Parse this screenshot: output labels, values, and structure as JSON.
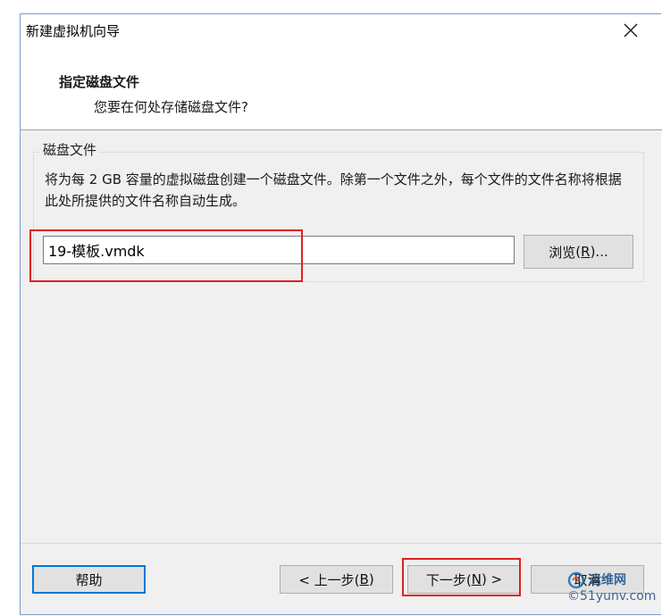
{
  "window": {
    "title": "新建虚拟机向导"
  },
  "header": {
    "title": "指定磁盘文件",
    "subtitle": "您要在何处存储磁盘文件?"
  },
  "disk_group": {
    "legend": "磁盘文件",
    "description": "将为每 2 GB 容量的虚拟磁盘创建一个磁盘文件。除第一个文件之外，每个文件的文件名称将根据此处所提供的文件名称自动生成。",
    "file_value": "19-模板.vmdk",
    "browse_label": "浏览",
    "browse_key": "R",
    "browse_suffix": ")..."
  },
  "buttons": {
    "help": "帮助",
    "back_prefix": "< 上一步(",
    "back_key": "B",
    "back_suffix": ")",
    "next_prefix": "下一步(",
    "next_key": "N",
    "next_suffix": ") >",
    "cancel": "取消"
  },
  "watermark": {
    "brand": "运维网",
    "site": "©51yunv.com"
  },
  "colors": {
    "highlight_box": "#e02020",
    "focus_border": "#0078d7"
  }
}
